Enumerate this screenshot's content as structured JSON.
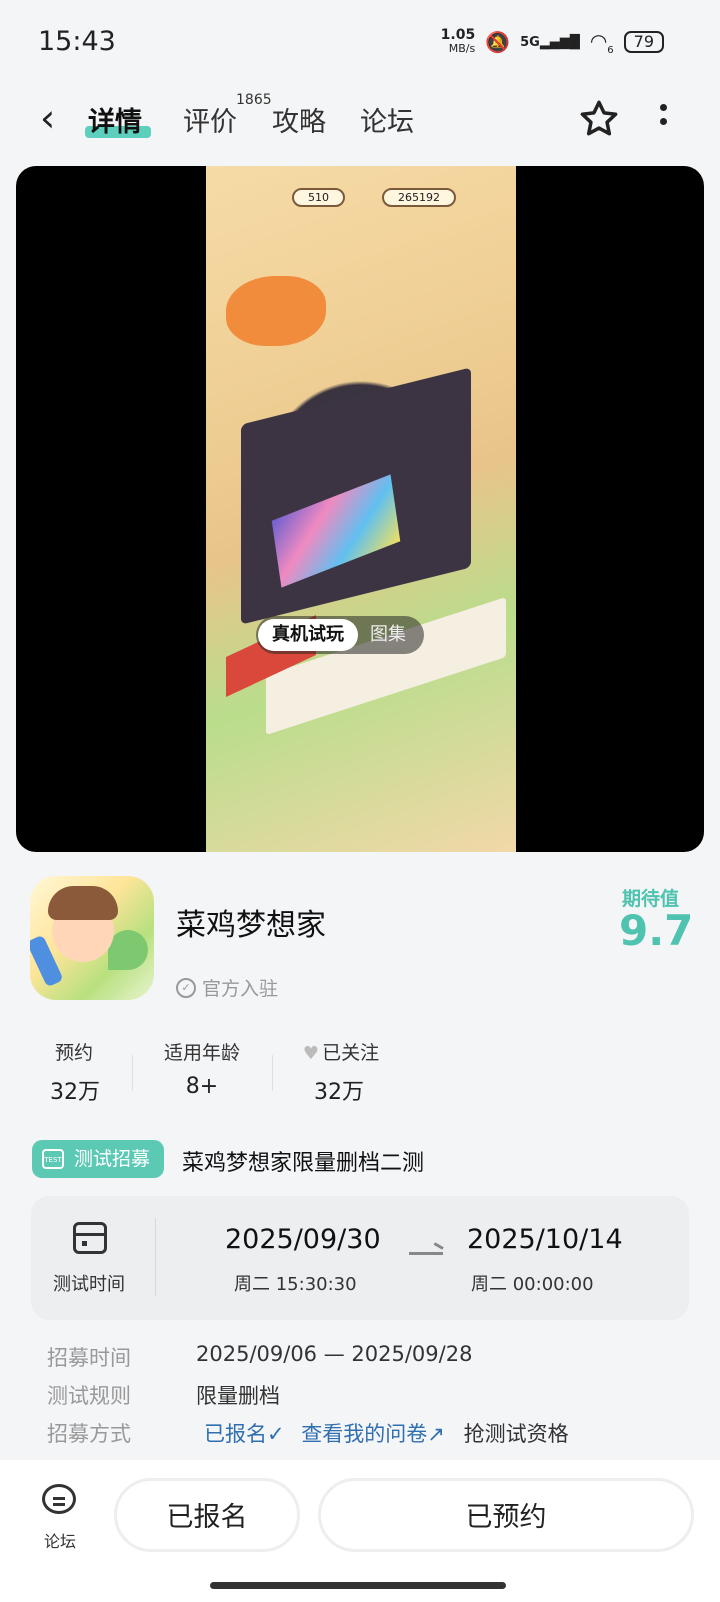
{
  "status_bar": {
    "time": "15:43",
    "net_speed_value": "1.05",
    "net_speed_unit": "MB/s",
    "signal": "5G",
    "wifi_badge": "6",
    "battery": "79"
  },
  "nav": {
    "tabs": [
      {
        "label": "详情",
        "active": true
      },
      {
        "label": "评价",
        "badge": "1865"
      },
      {
        "label": "攻略"
      },
      {
        "label": "论坛"
      }
    ]
  },
  "media": {
    "coins": "510",
    "gems": "265192",
    "toggle_options": [
      "真机试玩",
      "图集"
    ],
    "selected": "真机试玩"
  },
  "app": {
    "name": "菜鸡梦想家",
    "official_label": "官方入驻",
    "expect_label": "期待值",
    "expect_value": "9.7"
  },
  "stats": [
    {
      "label": "预约",
      "value": "32万"
    },
    {
      "label": "适用年龄",
      "value": "8+"
    },
    {
      "label": "已关注",
      "value": "32万"
    }
  ],
  "recruit": {
    "tag_icon_text": "TEST",
    "tag": "测试招募",
    "title": "菜鸡梦想家限量删档二测"
  },
  "test_time": {
    "label": "测试时间",
    "start_date": "2025/09/30",
    "start_sub": "周二  15:30:30",
    "end_date": "2025/10/14",
    "end_sub": "周二  00:00:00"
  },
  "details": [
    {
      "label": "招募时间",
      "value": "2025/09/06 — 2025/09/28"
    },
    {
      "label": "测试规则",
      "value": "限量删档"
    },
    {
      "label": "招募方式",
      "value": "抢测试资格",
      "registered": "已报名",
      "questionnaire": "查看我的问卷"
    }
  ],
  "bottom": {
    "forum_label": "论坛",
    "signed_up": "已报名",
    "reserved": "已预约"
  },
  "colors": {
    "accent": "#5cc9b5",
    "link": "#2f6fb0"
  }
}
